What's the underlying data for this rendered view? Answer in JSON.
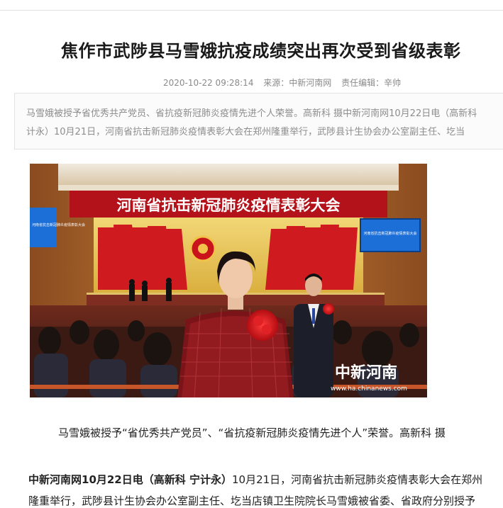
{
  "article": {
    "title": "焦作市武陟县马雪娥抗疫成绩突出再次受到省级表彰",
    "meta": {
      "datetime": "2020-10-22 09:28:14",
      "source": "来源：中新河南网",
      "editor": "责任编辑：辛帅"
    },
    "summary": {
      "line1": "马雪娥被授予省优秀共产党员、省抗疫新冠肺炎疫情先进个人荣誉。高新科  摄中新河南网10月22日电（高新科",
      "line2": "计永）10月21日，河南省抗击新冠肺炎疫情表彰大会在郑州隆重举行，武陟县计生协会办公室副主任、圪当"
    },
    "photo": {
      "banner": "河南省抗击新冠肺炎疫情表彰大会",
      "screen_left": "河南省抗击新冠肺炎疫情表彰大会",
      "screen_right": "河南省抗击新冠肺炎疫情表彰大会",
      "watermark_brand": "中新河南",
      "watermark_url": "www.ha.chinanews.com"
    },
    "caption": "马雪娥被授予“省优秀共产党员”、“省抗疫新冠肺炎疫情先进个人”荣誉。高新科  摄",
    "body": {
      "lead": "中新河南网10月22日电（高新科  宁计永）",
      "line1_rest": "10月21日，河南省抗击新冠肺炎疫情表彰大会在郑州",
      "line2": "隆重举行，武陟县计生协会办公室副主任、圪当店镇卫生院院长马雪娥被省委、省政府分别授予"
    }
  },
  "colors": {
    "stage_red": "#c0161b",
    "stage_gold": "#e7c85a",
    "wood": "#b06a2e",
    "screen_blue": "#1d6fd8"
  }
}
